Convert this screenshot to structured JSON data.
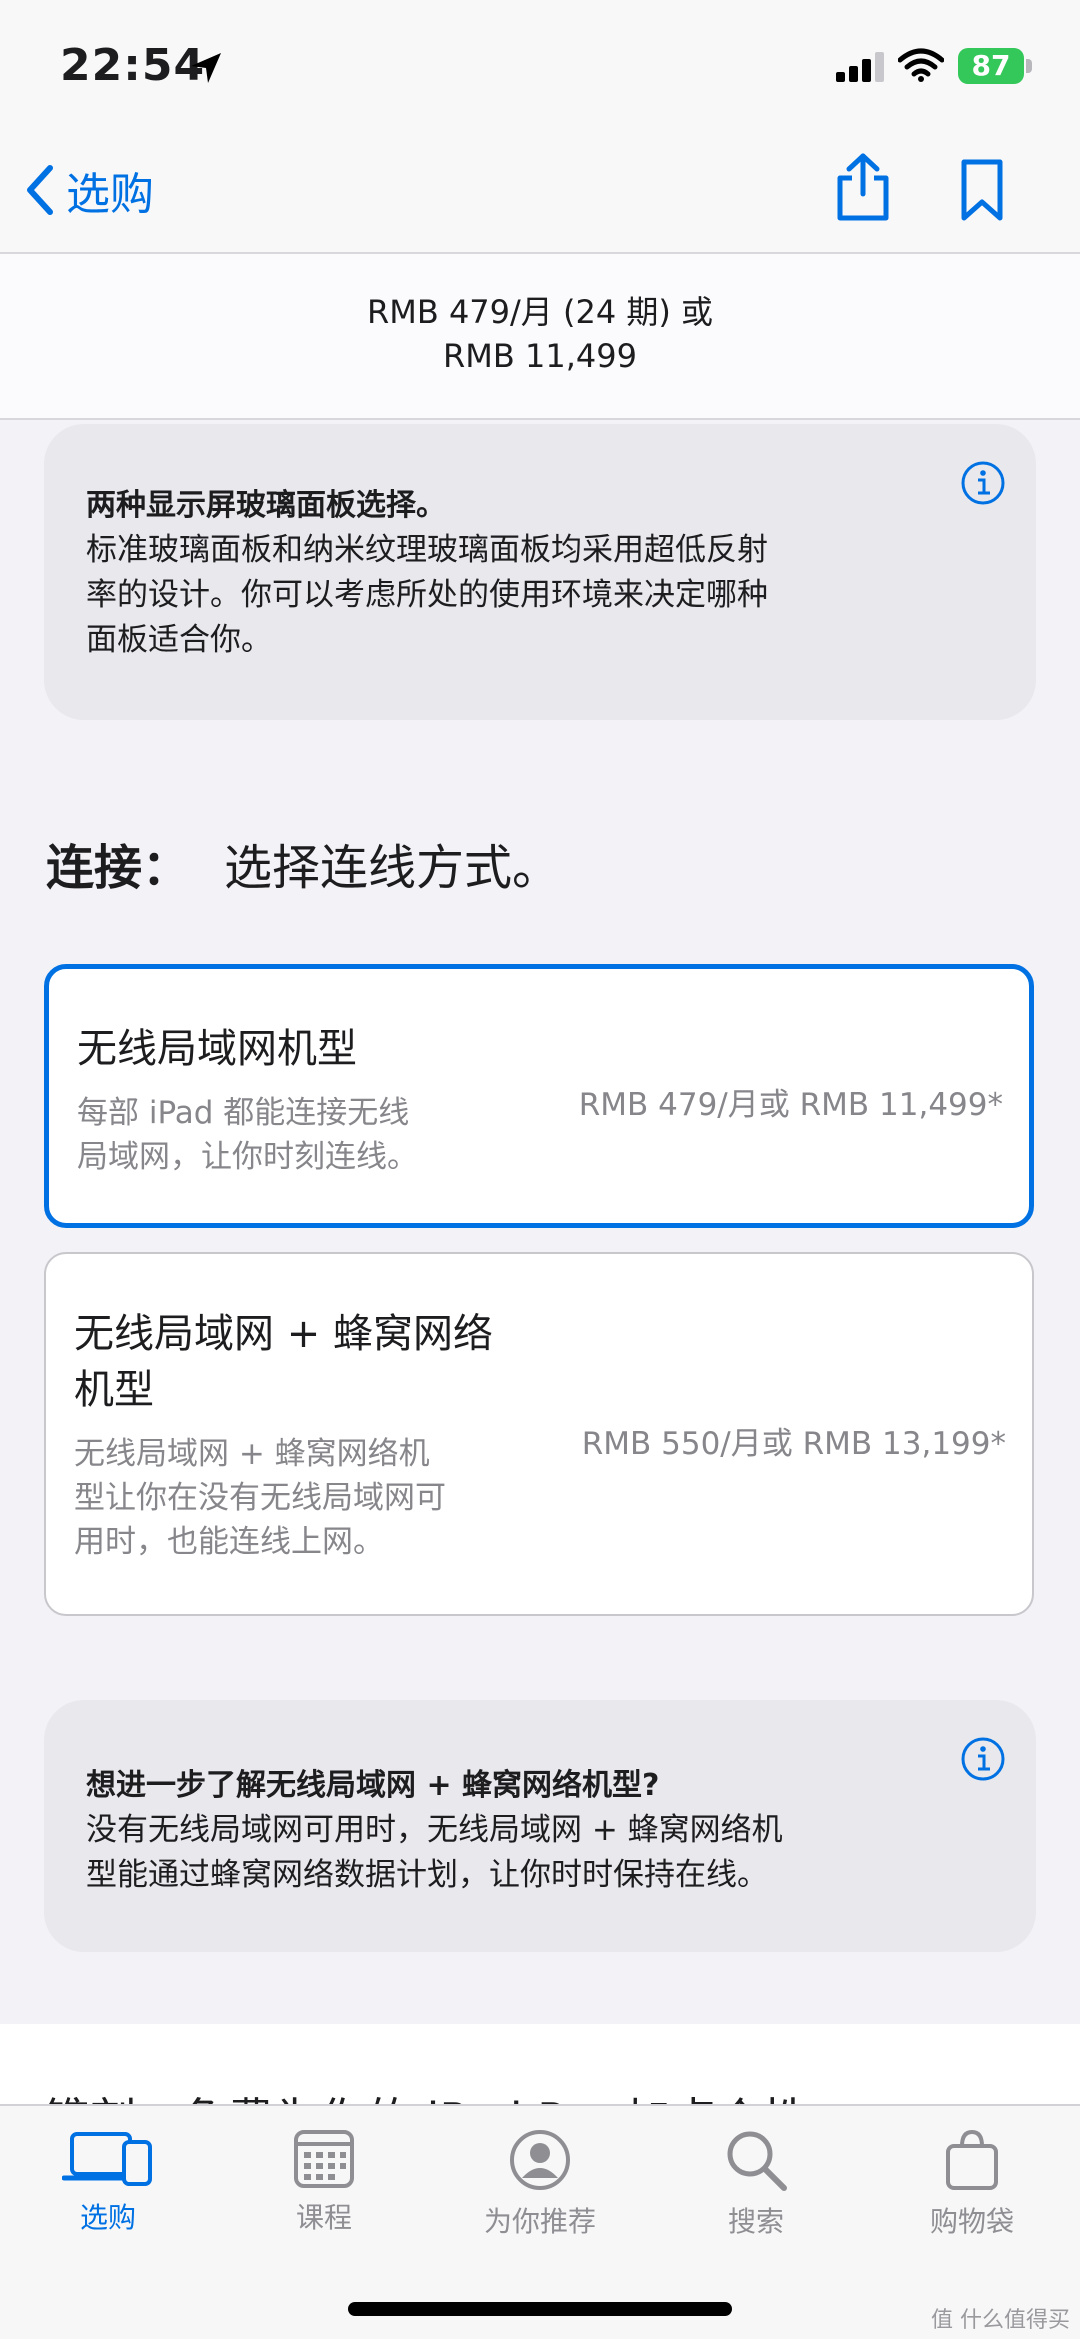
{
  "status": {
    "time": "22:54",
    "battery": "87"
  },
  "nav": {
    "back_label": "选购"
  },
  "price_header": {
    "line1": "RMB 479/月 (24 期) 或",
    "line2": "RMB 11,499"
  },
  "display_info": {
    "title": "两种显示屏玻璃面板选择。",
    "lines": [
      "标准玻璃面板和纳米纹理玻璃面板均采用超低反射",
      "率的设计。你可以考虑所处的使用环境来决定哪种",
      "面板适合你。"
    ]
  },
  "connectivity": {
    "label": "连接：",
    "prompt": "选择连线方式。",
    "options": [
      {
        "title_lines": [
          "无线局域网机型"
        ],
        "desc_lines": [
          "每部 iPad 都能连接无线",
          "局域网，让你时刻连线。"
        ],
        "price": "RMB 479/月或 RMB 11,499*"
      },
      {
        "title_lines": [
          "无线局域网 + 蜂窝网络",
          "机型"
        ],
        "desc_lines": [
          "无线局域网 + 蜂窝网络机",
          "型让你在没有无线局域网可",
          "用时，也能连线上网。"
        ],
        "price": "RMB 550/月或 RMB 13,199*"
      }
    ]
  },
  "cellular_info": {
    "title": "想进一步了解无线局域网 + 蜂窝网络机型?",
    "lines": [
      "没有无线局域网可用时，无线局域网 + 蜂窝网络机",
      "型能通过蜂窝网络数据计划，让你时时保持在线。"
    ]
  },
  "partial_section": "镌刻：免费为你的 iPad Pro 加点个性",
  "tabs": [
    {
      "label": "选购",
      "icon": "devices-icon"
    },
    {
      "label": "课程",
      "icon": "calendar-icon"
    },
    {
      "label": "为你推荐",
      "icon": "person-icon"
    },
    {
      "label": "搜索",
      "icon": "search-icon"
    },
    {
      "label": "购物袋",
      "icon": "bag-icon"
    }
  ],
  "watermark": "值 什么值得买",
  "colors": {
    "accent": "#0071e3",
    "battery": "#34c759",
    "background": "#f2f2f7",
    "card": "#e8e8ed",
    "secondary_text": "#86868b"
  }
}
